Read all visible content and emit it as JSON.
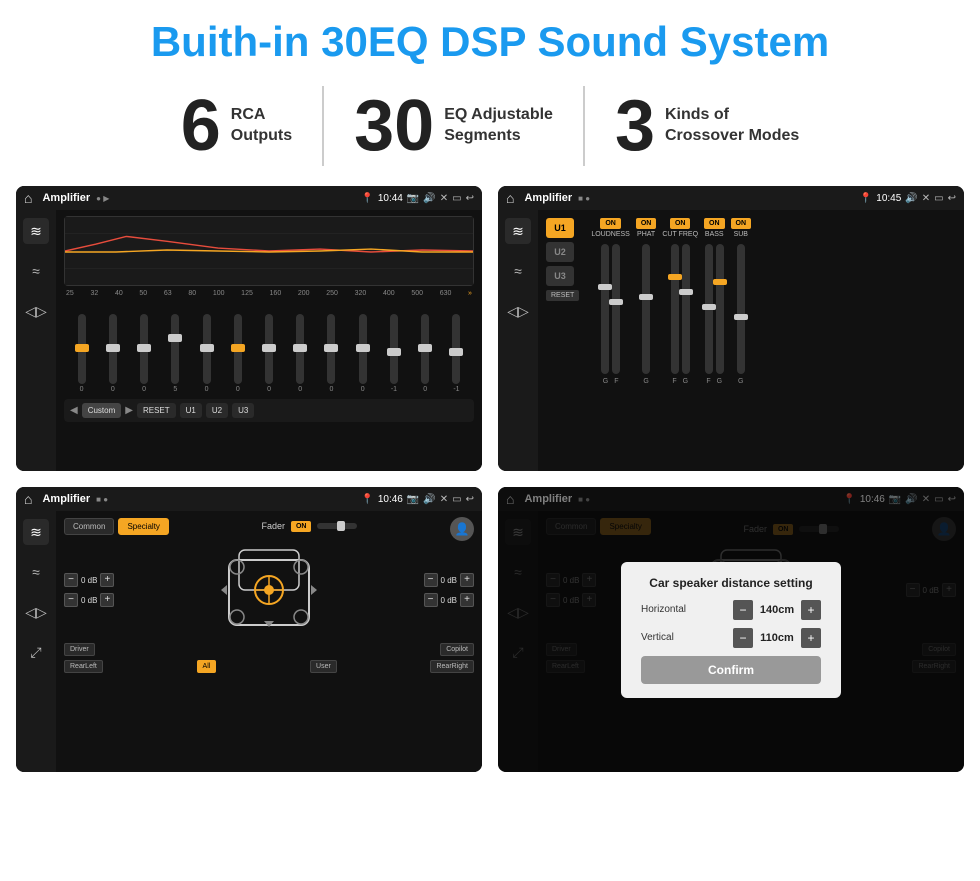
{
  "page": {
    "title": "Buith-in 30EQ DSP Sound System"
  },
  "stats": [
    {
      "number": "6",
      "text_line1": "RCA",
      "text_line2": "Outputs"
    },
    {
      "number": "30",
      "text_line1": "EQ Adjustable",
      "text_line2": "Segments"
    },
    {
      "number": "3",
      "text_line1": "Kinds of",
      "text_line2": "Crossover Modes"
    }
  ],
  "screen1": {
    "topbar": {
      "title": "Amplifier",
      "time": "10:44"
    },
    "freqs": [
      "25",
      "32",
      "40",
      "50",
      "63",
      "80",
      "100",
      "125",
      "160",
      "200",
      "250",
      "320",
      "400",
      "500",
      "630"
    ],
    "values": [
      "0",
      "0",
      "0",
      "5",
      "0",
      "0",
      "0",
      "0",
      "0",
      "0",
      "-1",
      "0",
      "-1"
    ],
    "bottom_btns": [
      "Custom",
      "RESET",
      "U1",
      "U2",
      "U3"
    ]
  },
  "screen2": {
    "topbar": {
      "title": "Amplifier",
      "time": "10:45"
    },
    "u_tabs": [
      "U1",
      "U2",
      "U3"
    ],
    "controls": [
      "LOUDNESS",
      "PHAT",
      "CUT FREQ",
      "BASS",
      "SUB"
    ],
    "on_states": [
      true,
      true,
      true,
      true,
      true
    ]
  },
  "screen3": {
    "topbar": {
      "title": "Amplifier",
      "time": "10:46"
    },
    "mode_tabs": [
      "Common",
      "Specialty"
    ],
    "fader_label": "Fader",
    "fader_on": "ON",
    "db_labels": [
      "0 dB",
      "0 dB",
      "0 dB",
      "0 dB"
    ],
    "bottom_btns": [
      "Driver",
      "Copilot",
      "RearLeft",
      "All",
      "User",
      "RearRight"
    ]
  },
  "screen4": {
    "topbar": {
      "title": "Amplifier",
      "time": "10:46"
    },
    "mode_tabs": [
      "Common",
      "Specialty"
    ],
    "dialog": {
      "title": "Car speaker distance setting",
      "horizontal_label": "Horizontal",
      "horizontal_value": "140cm",
      "vertical_label": "Vertical",
      "vertical_value": "110cm",
      "confirm_label": "Confirm"
    },
    "bottom_btns": [
      "Driver",
      "Copilot",
      "RearLeft",
      "User",
      "RearRight"
    ]
  },
  "icons": {
    "home": "⌂",
    "back": "↩",
    "settings": "⚙",
    "eq": "≋",
    "wave": "≈",
    "vol": "🔊",
    "speaker": "📢",
    "person": "👤",
    "pin": "📍",
    "camera": "📷",
    "minus": "−",
    "plus": "+"
  }
}
